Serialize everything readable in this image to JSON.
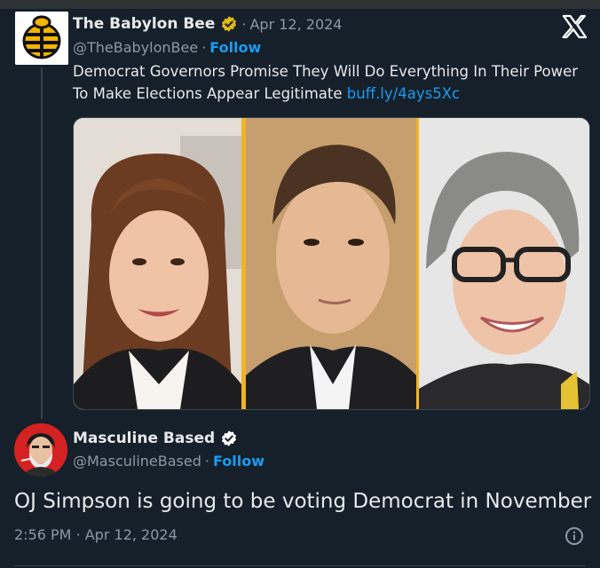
{
  "quoted_tweet": {
    "author_name": "The Babylon Bee",
    "verified_badge": "gold-check",
    "separator": "·",
    "date": "Apr 12, 2024",
    "handle": "@TheBabylonBee",
    "follow_label": "Follow",
    "text": "Democrat Governors Promise They Will Do Everything In Their Power To Make Elections Appear Legitimate",
    "link": "buff.ly/4ays5Xc"
  },
  "main_tweet": {
    "author_name": "Masculine Based",
    "verified_badge": "blue-check",
    "handle": "@MasculineBased",
    "separator": "·",
    "follow_label": "Follow",
    "text": "OJ Simpson is going to be voting Democrat in November",
    "time": "2:56 PM",
    "date": "Apr 12, 2024"
  },
  "colors": {
    "background": "#15202b",
    "accent": "#1d9bf0",
    "muted": "#8b98a5",
    "gold": "#f4b400"
  },
  "icons": [
    "x-logo-icon",
    "info-icon",
    "verified-badge-icon"
  ]
}
